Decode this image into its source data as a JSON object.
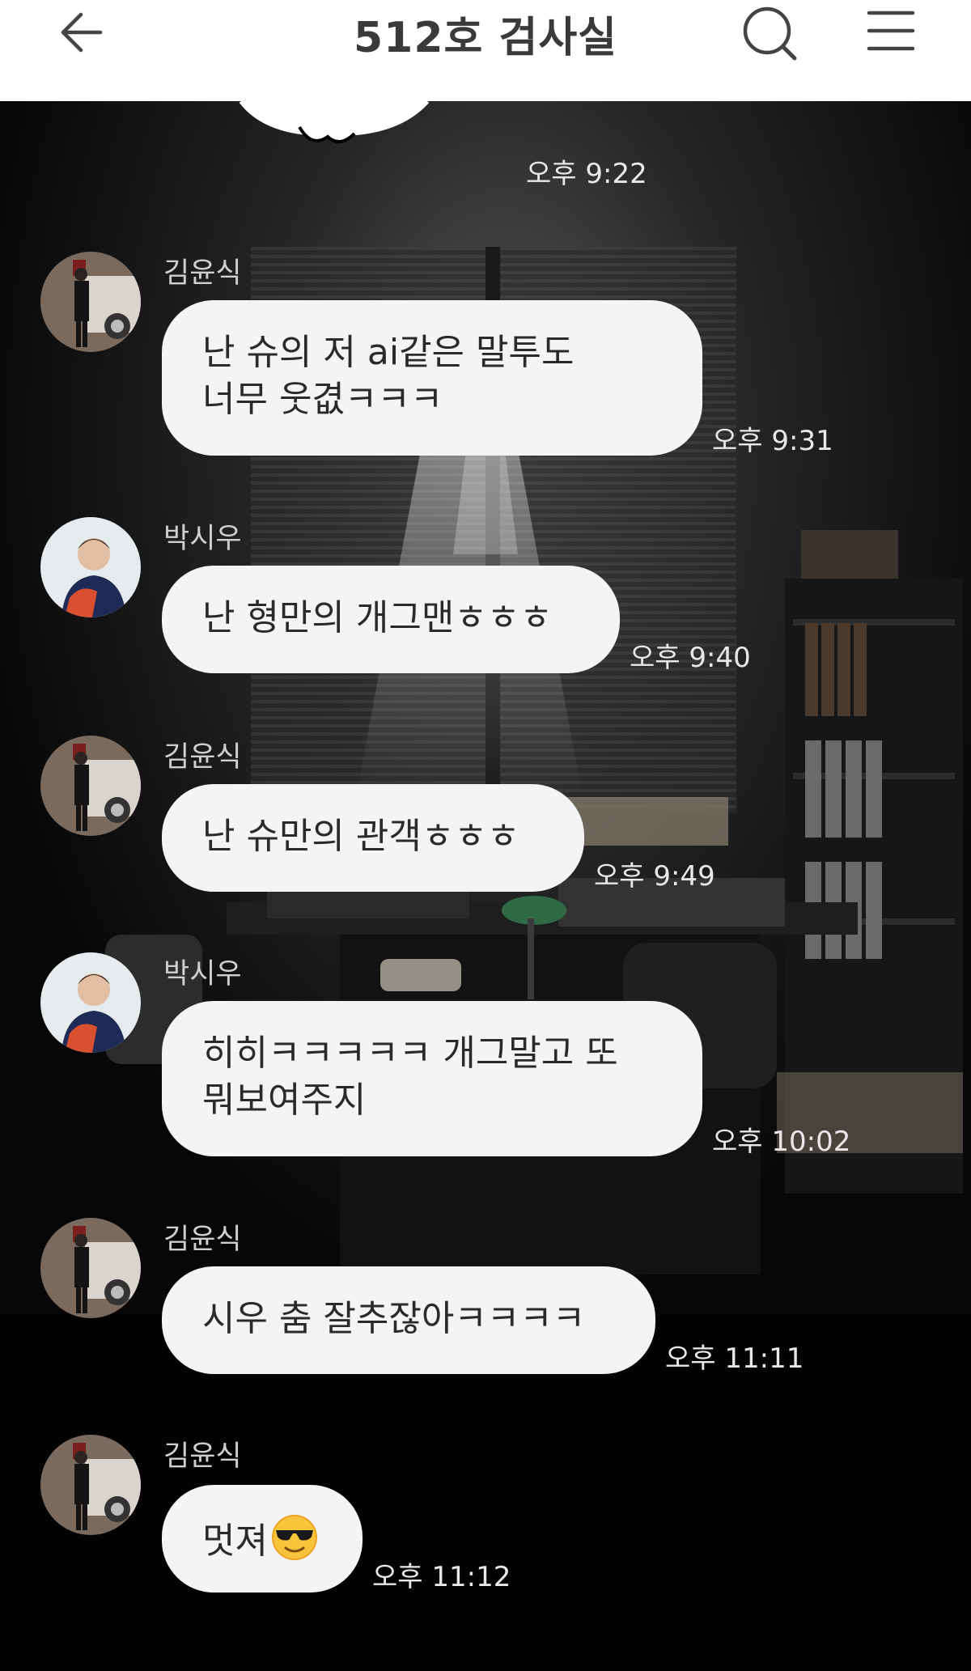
{
  "header": {
    "title": "512호 검사실",
    "back_icon": "arrow-left-icon",
    "search_icon": "search-icon",
    "menu_icon": "hamburger-menu-icon"
  },
  "theme": {
    "header_bg": "#ffffff",
    "bubble_bg": "#f4f4f6",
    "timestamp_color": "#e8e8e8",
    "name_color": "#cfcfcf"
  },
  "sticker": {
    "time": "오후 9:22"
  },
  "messages": [
    {
      "sender": "김윤식",
      "text": "난 슈의 저 ai같은 말투도\n너무 웃겺ㅋㅋㅋ",
      "time": "오후 9:31"
    },
    {
      "sender": "박시우",
      "text": "난 형만의 개그맨ㅎㅎㅎ",
      "time": "오후 9:40"
    },
    {
      "sender": "김윤식",
      "text": "난 슈만의 관객ㅎㅎㅎ",
      "time": "오후 9:49"
    },
    {
      "sender": "박시우",
      "text": "히히ㅋㅋㅋㅋㅋ 개그말고 또\n뭐보여주지",
      "time": "오후 10:02"
    },
    {
      "sender": "김윤식",
      "text": "시우 춤 잘추잖아ㅋㅋㅋㅋ",
      "time": "오후 11:11"
    },
    {
      "sender": "김윤식",
      "text": "멋져",
      "emoji": "sunglasses-face-emoji",
      "time": "오후 11:12"
    }
  ]
}
